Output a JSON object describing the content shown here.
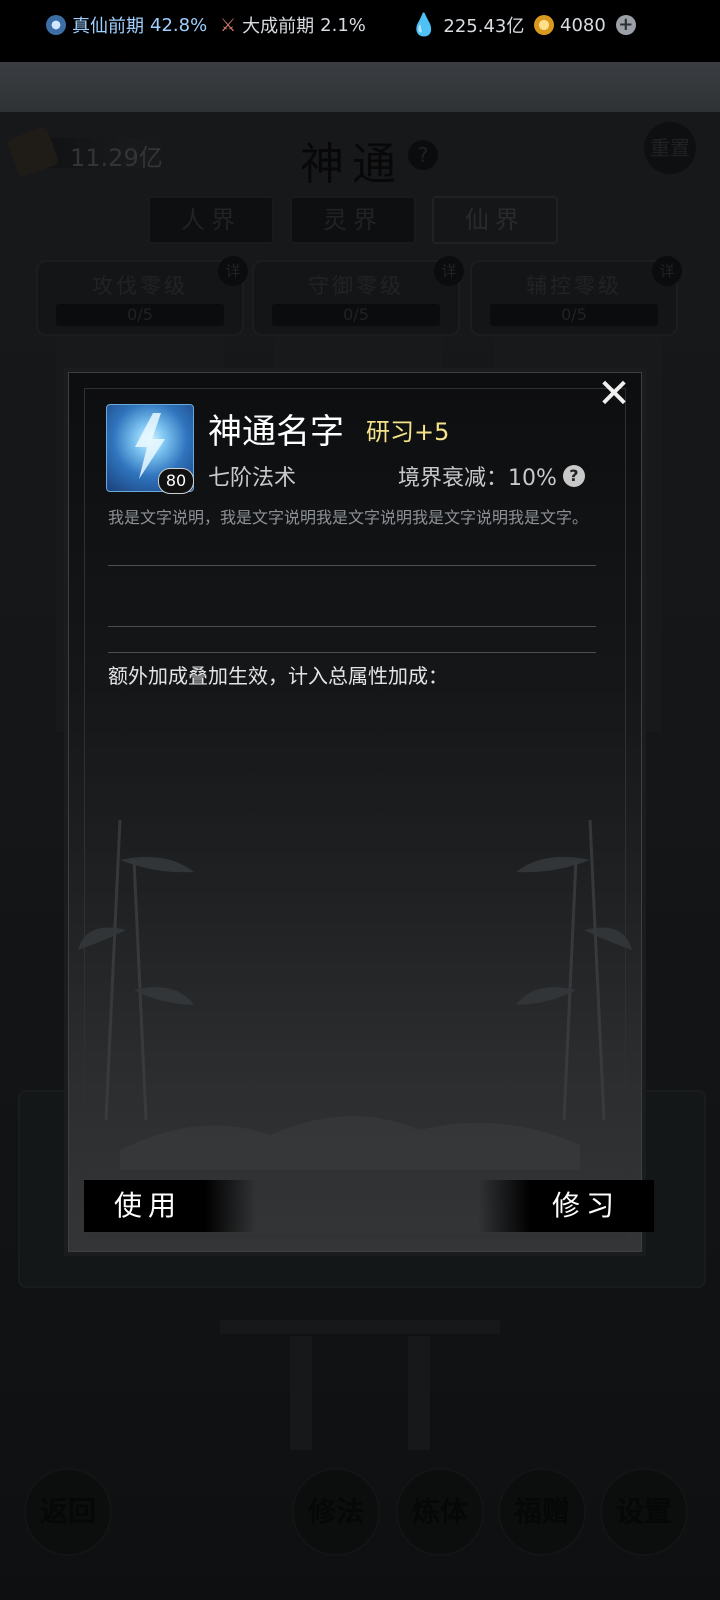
{
  "resources": {
    "realm1": {
      "name": "真仙前期",
      "percent": "42.8%"
    },
    "realm2": {
      "name": "大成前期",
      "percent": "2.1%"
    },
    "spirit_stones": "225.43亿",
    "gold": "4080"
  },
  "page": {
    "scroll_amount": "11.29亿",
    "title": "神通",
    "help": "?",
    "reset_label": "重置",
    "realm_tabs": [
      "人界",
      "灵界",
      "仙界"
    ],
    "active_tab": "仙界",
    "categories": [
      {
        "name": "攻伐零级",
        "progress": "0/5",
        "detail": "详"
      },
      {
        "name": "守御零级",
        "progress": "0/5",
        "detail": "详"
      },
      {
        "name": "辅控零级",
        "progress": "0/5",
        "detail": "详"
      }
    ],
    "bottom_nav": [
      "返回",
      "修法",
      "炼体",
      "福赠",
      "设置"
    ]
  },
  "modal": {
    "close": "✕",
    "skill_name": "神通名字",
    "study_level": "研习+5",
    "level_badge": "80",
    "skill_class": "七阶法术",
    "decay_label": "境界衰减：10%",
    "decay_help": "?",
    "description": "我是文字说明，我是文字说明我是文字说明我是文字说明我是文字。",
    "bonus_title": "额外加成叠加生效，计入总属性加成：",
    "use_button": "使用",
    "study_button": "修习"
  },
  "colors": {
    "study_tag": "#f4e38a",
    "realm_highlight": "#9fd0ff"
  }
}
